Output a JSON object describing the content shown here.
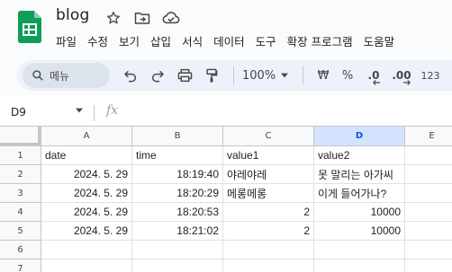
{
  "app": {
    "title": "blog",
    "brand_color": "#0f9d58"
  },
  "title_icons": [
    "star-icon",
    "move-to-folder-icon",
    "cloud-saved-icon"
  ],
  "menu": [
    "파일",
    "수정",
    "보기",
    "삽입",
    "서식",
    "데이터",
    "도구",
    "확장 프로그램",
    "도움말"
  ],
  "toolbar": {
    "search_label": "메뉴",
    "zoom": "100%",
    "currency": "₩",
    "percent": "%",
    "decrease_decimal": ".0",
    "increase_decimal": ".00",
    "number_format": "123"
  },
  "formula_bar": {
    "name_box": "D9",
    "fx": "fx"
  },
  "sheet": {
    "columns": [
      "A",
      "B",
      "C",
      "D",
      "E"
    ],
    "selected_column": "D",
    "rows": [
      "1",
      "2",
      "3",
      "4",
      "5",
      "6",
      "7"
    ],
    "cells": [
      [
        "date",
        "time",
        "value1",
        "value2",
        ""
      ],
      [
        "2024. 5. 29",
        "18:19:40",
        "야레야레",
        "못 말리는 아가씨",
        ""
      ],
      [
        "2024. 5. 29",
        "18:20:29",
        "메롱메롱",
        "이게 들어가나?",
        ""
      ],
      [
        "2024. 5. 29",
        "18:20:53",
        "2",
        "10000",
        ""
      ],
      [
        "2024. 5. 29",
        "18:21:02",
        "2",
        "10000",
        ""
      ],
      [
        "",
        "",
        "",
        "",
        ""
      ],
      [
        "",
        "",
        "",
        "",
        ""
      ]
    ]
  }
}
